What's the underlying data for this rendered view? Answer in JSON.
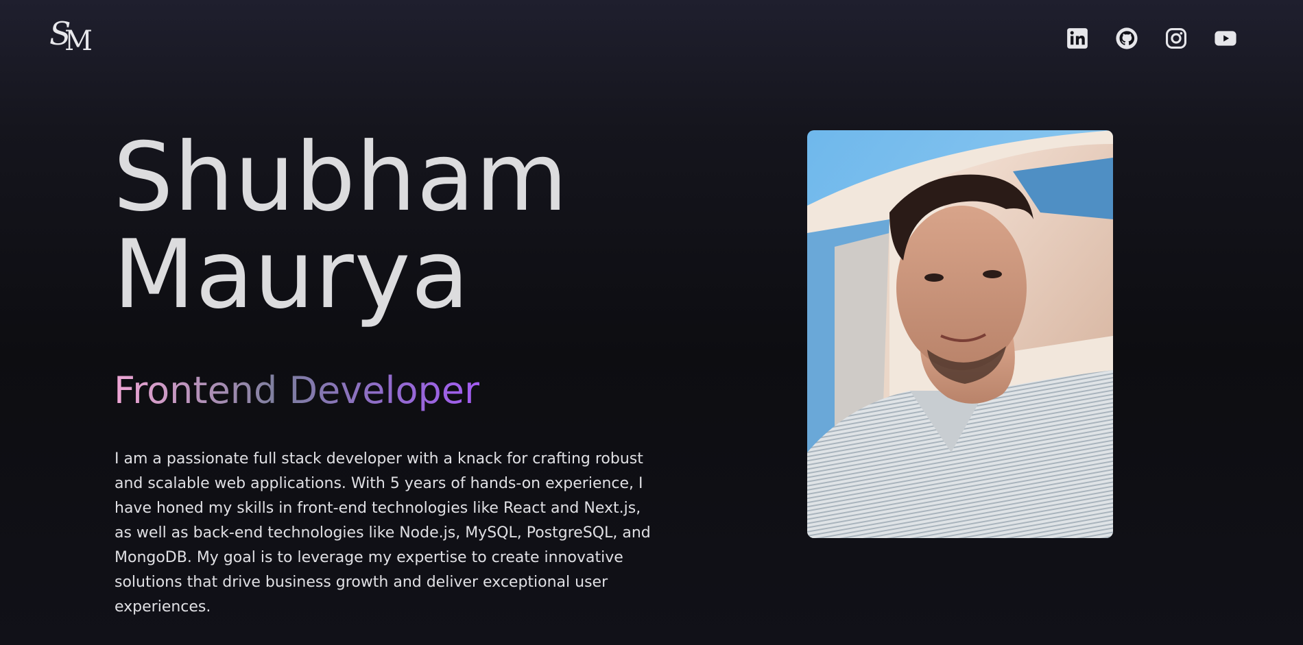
{
  "header": {
    "logo_text": "SM",
    "socials": [
      {
        "icon": "linkedin-icon",
        "label": "LinkedIn"
      },
      {
        "icon": "github-icon",
        "label": "GitHub"
      },
      {
        "icon": "instagram-icon",
        "label": "Instagram"
      },
      {
        "icon": "youtube-icon",
        "label": "YouTube"
      }
    ]
  },
  "hero": {
    "first_name": "Shubham",
    "last_name": "Maurya",
    "role": "Frontend Developer",
    "bio": "I am a passionate full stack developer with a knack for crafting robust and scalable web applications. With 5 years of hands-on experience, I have honed my skills in front-end technologies like React and Next.js, as well as back-end technologies like Node.js, MySQL, PostgreSQL, and MongoDB. My goal is to leverage my expertise to create innovative solutions that drive business growth and deliver exceptional user experiences."
  },
  "colors": {
    "background": "#101017",
    "text": "#dcdcde",
    "gradient_start": "#f0a6d6",
    "gradient_mid": "#7d7f9e",
    "gradient_end": "#a35cf2"
  }
}
